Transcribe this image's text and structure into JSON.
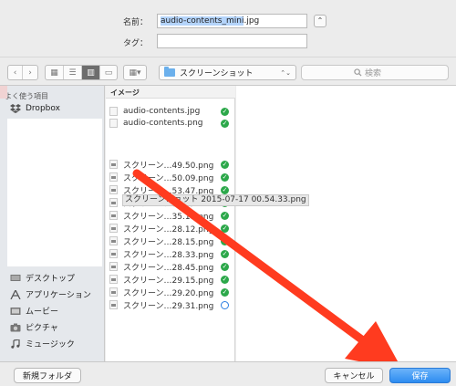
{
  "form": {
    "name_label": "名前：",
    "name_selected": "audio-contents_mini",
    "name_ext": ".jpg",
    "tags_label": "タグ：",
    "tags_value": "",
    "expand_symbol": "⌃"
  },
  "toolbar": {
    "back_symbol": "‹",
    "forward_symbol": "›",
    "view_icon_symbol": "▦",
    "view_list_symbol": "☰",
    "view_column_symbol": "▥",
    "view_cover_symbol": "▭",
    "arrange_symbol": "▦▾",
    "location": "スクリーンショット",
    "location_arrow": "⌃⌄",
    "search_placeholder": "検索"
  },
  "sidebar": {
    "header": "よく使う項目",
    "dropbox": "Dropbox",
    "desktop": "デスクトップ",
    "applications": "アプリケーション",
    "movies": "ムービー",
    "pictures": "ピクチャ",
    "music": "ミュージック"
  },
  "column": {
    "header": "イメージ",
    "files": [
      {
        "name": "audio-contents.jpg",
        "status": "check"
      },
      {
        "name": "audio-contents.png",
        "status": "check"
      },
      {
        "name": "スクリーン…49.50.png",
        "status": "check"
      },
      {
        "name": "スクリーン…50.09.png",
        "status": "check"
      },
      {
        "name": "スクリーン…53.47.png",
        "status": "check"
      },
      {
        "name": "スクリーンショット 2015-07-17 00.54.33.png",
        "status": "check"
      },
      {
        "name": "スクリーン…35.19.png",
        "status": "check"
      },
      {
        "name": "スクリーン…28.12.png",
        "status": "check"
      },
      {
        "name": "スクリーン…28.15.png",
        "status": "check"
      },
      {
        "name": "スクリーン…28.33.png",
        "status": "check"
      },
      {
        "name": "スクリーン…28.45.png",
        "status": "check"
      },
      {
        "name": "スクリーン…29.15.png",
        "status": "check"
      },
      {
        "name": "スクリーン…29.20.png",
        "status": "check"
      },
      {
        "name": "スクリーン…29.31.png",
        "status": "sync"
      }
    ],
    "tooltip": "スクリーンショット 2015-07-17 00.54.33.png"
  },
  "buttons": {
    "new_folder": "新規フォルダ",
    "cancel": "キャンセル",
    "save": "保存"
  },
  "colors": {
    "accent": "#2d8cf0",
    "arrow": "#ff3b1f",
    "check": "#2ca84a"
  }
}
